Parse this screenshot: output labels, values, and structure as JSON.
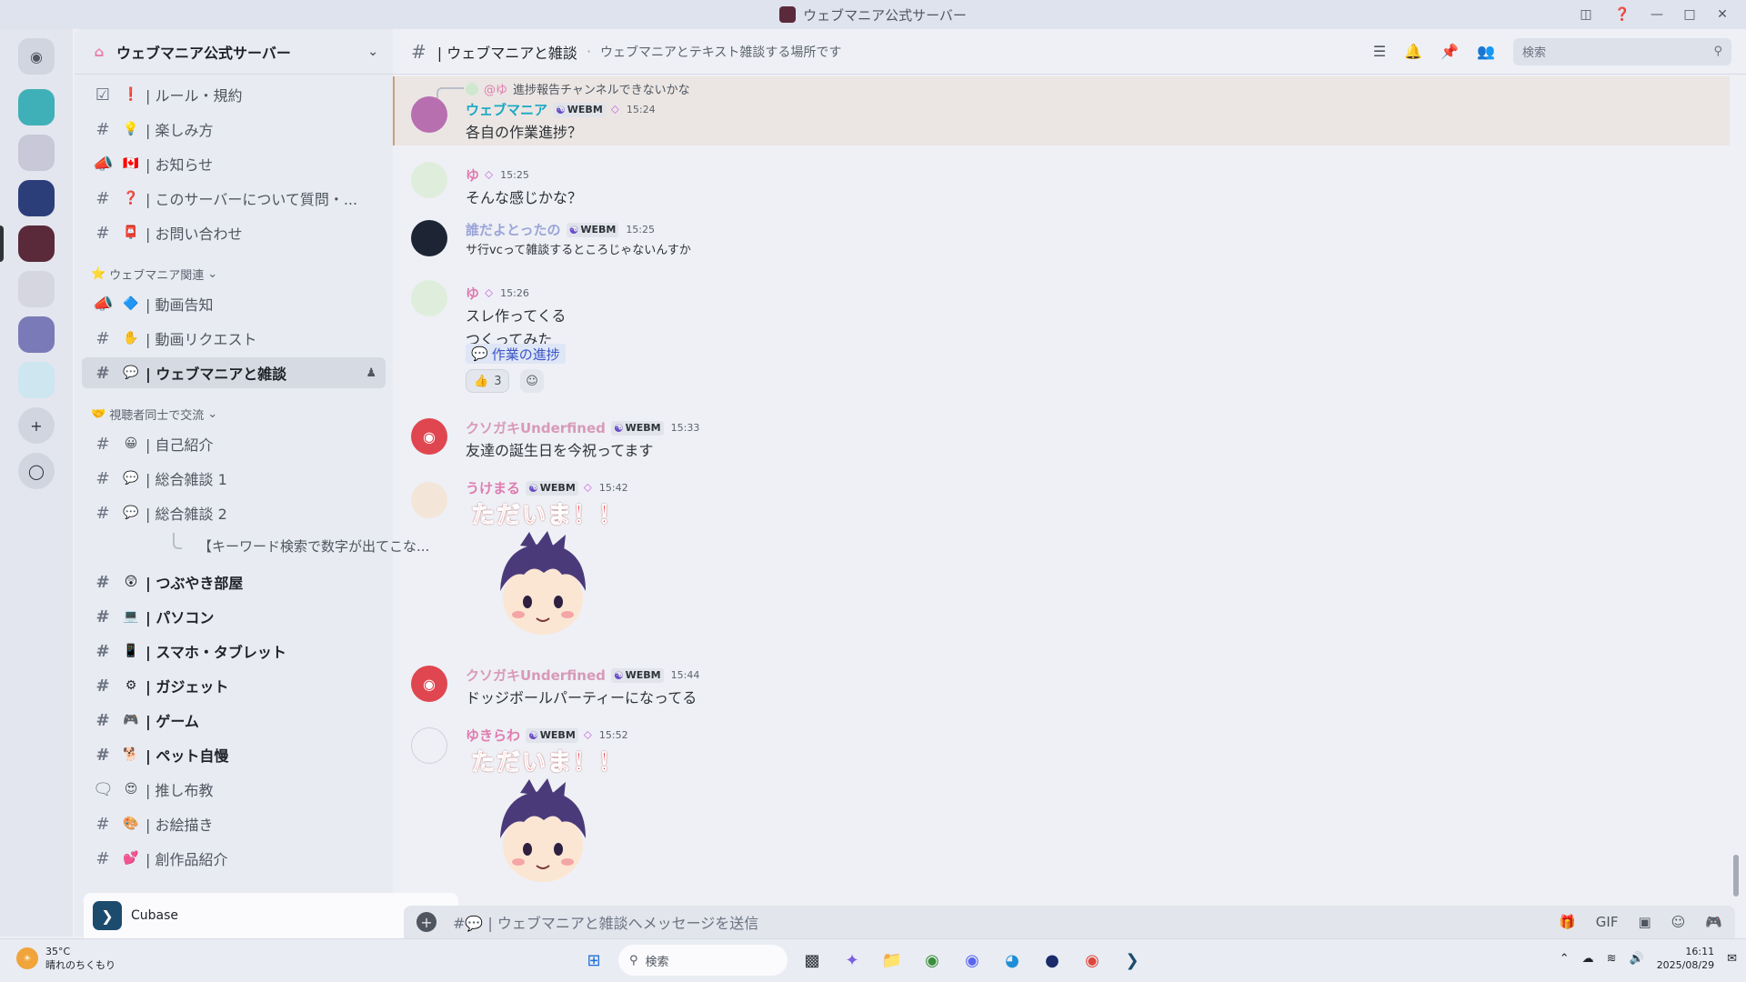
{
  "window": {
    "title": "ウェブマニア公式サーバー"
  },
  "server": {
    "name": "ウェブマニア公式サーバー"
  },
  "channels_top": [
    {
      "label": "| ルール・規約",
      "emoji": "❗",
      "icon": "check-square-icon"
    },
    {
      "label": "| 楽しみ方",
      "emoji": "💡",
      "icon": "hash-icon"
    },
    {
      "label": "| お知らせ",
      "emoji": "🇨🇦",
      "icon": "megaphone-icon"
    },
    {
      "label": "| このサーバーについて質問・...",
      "emoji": "❓",
      "icon": "hash-icon"
    },
    {
      "label": "| お問い合わせ",
      "emoji": "📮",
      "icon": "hash-icon"
    }
  ],
  "category1": {
    "label": "ウェブマニア関連",
    "emoji": "⭐"
  },
  "channels_cat1": [
    {
      "label": "| 動画告知",
      "emoji": "🔷",
      "icon": "megaphone-icon"
    },
    {
      "label": "| 動画リクエスト",
      "emoji": "✋",
      "icon": "hash-icon"
    },
    {
      "label": "| ウェブマニアと雑談",
      "emoji": "💬",
      "icon": "hash-icon"
    }
  ],
  "category2": {
    "label": "視聴者同士で交流",
    "emoji": "🤝"
  },
  "channels_cat2": [
    {
      "label": "| 自己紹介",
      "emoji": "😀"
    },
    {
      "label": "| 総合雑談 1",
      "emoji": "💬"
    },
    {
      "label": "| 総合雑談 2",
      "emoji": "💬"
    }
  ],
  "thread_item": "【キーワード検索で数字が出てこな...",
  "channels_bold": [
    {
      "label": "| つぶやき部屋",
      "emoji": "😲"
    },
    {
      "label": "| パソコン",
      "emoji": "💻"
    },
    {
      "label": "| スマホ・タブレット",
      "emoji": "📱"
    },
    {
      "label": "| ガジェット",
      "emoji": "⚙"
    },
    {
      "label": "| ゲーム",
      "emoji": "🎮"
    },
    {
      "label": "| ペット自慢",
      "emoji": "🐕"
    }
  ],
  "channels_bottom": [
    {
      "label": "| 推し布教",
      "emoji": "😍",
      "icon": "forum-icon"
    },
    {
      "label": "| お絵描き",
      "emoji": "🎨",
      "icon": "hash-icon"
    },
    {
      "label": "| 創作品紹介",
      "emoji": "💕",
      "icon": "hash-icon"
    }
  ],
  "voice_activity": {
    "app_name": "Cubase"
  },
  "chat_header": {
    "channel": "| ウェブマニアと雑談",
    "topic": "ウェブマニアとテキスト雑談する場所です",
    "search_placeholder": "検索"
  },
  "messages": {
    "reply_preview": {
      "mention": "@ゆ",
      "text": "進捗報告チャンネルできないかな"
    },
    "m1": {
      "user": "ウェブマニア",
      "tag": "WEBM",
      "time": "15:24",
      "text": "各自の作業進捗？",
      "color": "#1aa7c4"
    },
    "m2": {
      "user": "ゆ",
      "time": "15:25",
      "text": "そんな感じかな？",
      "color": "#e07cb0"
    },
    "m3": {
      "user": "誰だよとったの",
      "tag": "WEBM",
      "time": "15:25",
      "text": "サ行vcって雑談するところじゃないんすか",
      "color": "#9aa4d8"
    },
    "m4": {
      "user": "ゆ",
      "time": "15:26",
      "line1": "スレ作ってくる",
      "line2": "つくってみた",
      "thread": "作業の進捗",
      "reaction_count": "3",
      "color": "#e07cb0"
    },
    "m5": {
      "user": "クソガキUnderfined",
      "tag": "WEBM",
      "time": "15:33",
      "text": "友達の誕生日を今祝ってます",
      "color": "#d89ab6"
    },
    "m6": {
      "user": "うけまる",
      "tag": "WEBM",
      "time": "15:42",
      "sticker_text": "ただいま！！",
      "color": "#e07cb0"
    },
    "m7": {
      "user": "クソガキUnderfined",
      "tag": "WEBM",
      "time": "15:44",
      "text": "ドッジボールパーティーになってる",
      "color": "#d89ab6"
    },
    "m8": {
      "user": "ゆきらわ",
      "tag": "WEBM",
      "time": "15:52",
      "sticker_text": "ただいま！！",
      "color": "#e07cb0"
    }
  },
  "composer": {
    "placeholder": "#💬 | ウェブマニアと雑談へメッセージを送信"
  },
  "taskbar": {
    "temp": "35°C",
    "weather": "晴れのちくもり",
    "search_placeholder": "検索",
    "time": "16:11",
    "date": "2025/08/29"
  }
}
